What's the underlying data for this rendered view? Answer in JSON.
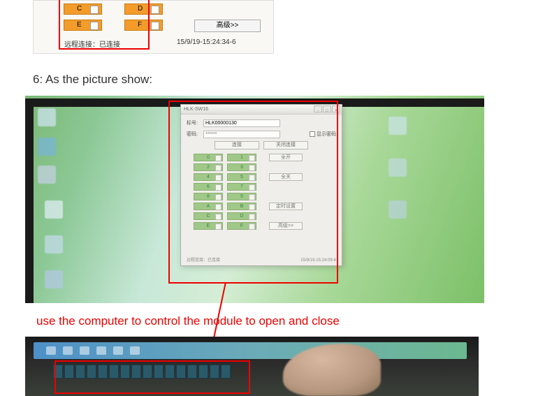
{
  "top_app": {
    "buttons": {
      "c": "C",
      "d": "D",
      "e": "E",
      "f": "F"
    },
    "advanced_label": "高级>>",
    "status": "远程连接：已连接",
    "timestamp": "15/9/19-15:24:34-6"
  },
  "heading": "6: As the picture show:",
  "app_window": {
    "title": "HLK-SW16",
    "label_id": "标号:",
    "id_value": "HLK00000130",
    "label_pwd": "密码:",
    "pwd_placeholder": "******",
    "checkbox_label": "显示密码",
    "btn_link": "连接",
    "btn_disconn": "关闭连接",
    "relays_left": [
      "0",
      "2",
      "4",
      "6",
      "8",
      "A",
      "C",
      "E"
    ],
    "relays_right": [
      "1",
      "3",
      "5",
      "7",
      "9",
      "B",
      "D",
      "F"
    ],
    "side_btn_open": "全开",
    "side_btn_close": "全关",
    "side_btn_timer": "定时设置",
    "side_btn_adv": "高级>>",
    "bottom_status": "远程连接：已连接",
    "bottom_ts": "15/9/19-15:24:09-6"
  },
  "red_caption": "use the computer to control the module to open and close"
}
